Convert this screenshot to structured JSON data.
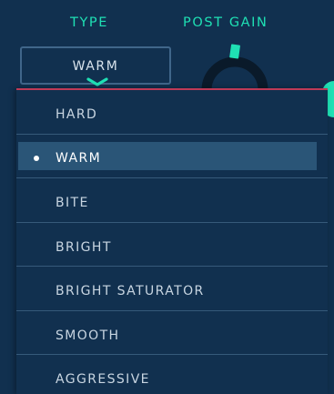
{
  "header": {
    "type_label": "TYPE",
    "post_gain_label": "POST GAIN"
  },
  "type_select": {
    "value": "WARM",
    "expanded": true
  },
  "post_gain_knob": {
    "icon": "knob-icon",
    "accent_color": "#1fe0b4"
  },
  "dropdown": {
    "items": [
      {
        "label": "HARD",
        "selected": false
      },
      {
        "label": "WARM",
        "selected": true
      },
      {
        "label": "BITE",
        "selected": false
      },
      {
        "label": "BRIGHT",
        "selected": false
      },
      {
        "label": "BRIGHT SATURATOR",
        "selected": false
      },
      {
        "label": "SMOOTH",
        "selected": false
      },
      {
        "label": "AGGRESSIVE",
        "selected": false
      }
    ]
  },
  "colors": {
    "background": "#11304f",
    "accent": "#1fe0b4",
    "menu_top_border": "#bf3a57",
    "selected_row": "#2a5577",
    "divider": "#365a7a",
    "text": "#c8d5e1"
  }
}
